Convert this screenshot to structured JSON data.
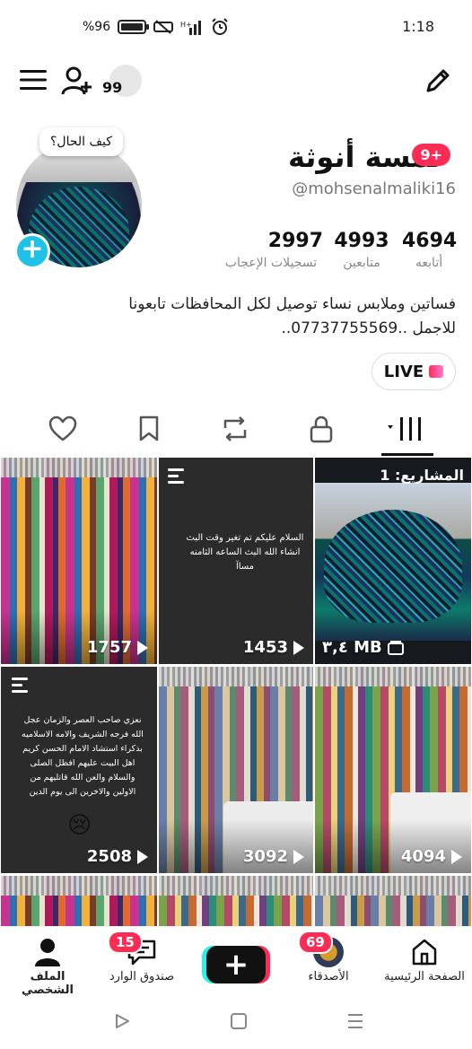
{
  "status": {
    "time": "1:18",
    "battery": "%96",
    "battery_level": 0.96
  },
  "header": {
    "menu_icon": "hamburger-icon",
    "add_friend_icon": "add-user-icon",
    "visitors_count": "99",
    "edit_icon": "pencil-icon"
  },
  "profile": {
    "bubble": "كيف الحال؟",
    "name": "لمسة أنوثة",
    "name_badge": "9+",
    "username": "@mohsenalmaliki16",
    "stats": [
      {
        "num": "4694",
        "label": "أتابعه"
      },
      {
        "num": "4993",
        "label": "متابعين"
      },
      {
        "num": "2997",
        "label": "تسجيلات الإعجاب"
      }
    ],
    "bio_line1": "فساتين وملابس نساء توصيل لكل المحافظات تابعونا",
    "bio_line2": "للاجمل ..07737755569..",
    "live_label": "LIVE"
  },
  "tabs": [
    "videos-grid-icon",
    "lock-icon",
    "repost-icon",
    "bookmark-icon",
    "heart-icon"
  ],
  "grid": {
    "tiles": [
      {
        "count": "1757",
        "kind": "video"
      },
      {
        "count": "1453",
        "kind": "text",
        "text": "السلام عليكم تم تغير وقت البث انشاء الله البث الساعه الثامنه مساآ"
      },
      {
        "count": "٣,٤ MB",
        "kind": "draft",
        "label": "المشاريع: 1"
      },
      {
        "count": "2508",
        "kind": "text",
        "text": "نعزي صاحب العصر والزمان عجل الله فرجه الشريف والامه الاسلاميه بذكراء استشاد الامام الحسن كريم اهل البيت عليهم افظل الصلى والسلام والعن الله قاتليهم من الاولين والاخرين الى يوم الدين",
        "emoji": "😢"
      },
      {
        "count": "3092",
        "kind": "video"
      },
      {
        "count": "4094",
        "kind": "video"
      }
    ]
  },
  "bottom_nav": {
    "home": "الصفحة الرئيسية",
    "friends": "الأصدقاء",
    "friends_badge": "69",
    "create": "+",
    "inbox": "صندوق الوارد",
    "inbox_badge": "15",
    "profile": "الملف الشخصي"
  },
  "colors": {
    "accent": "#fe2c55",
    "cyan": "#25f4ee",
    "add_blue": "#20c1e8"
  }
}
